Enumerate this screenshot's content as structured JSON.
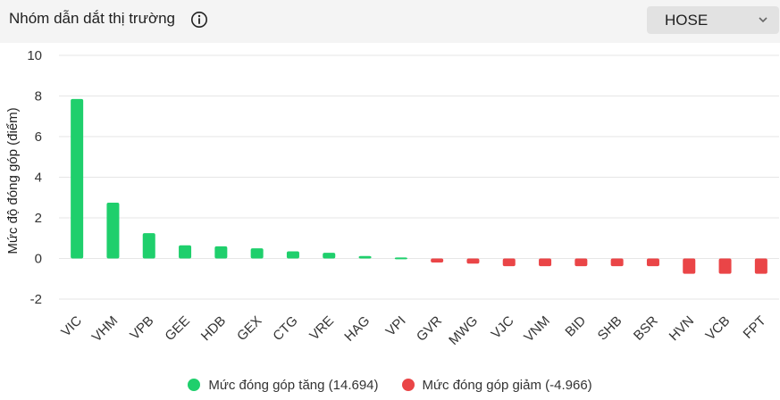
{
  "header": {
    "title": "Nhóm dẫn dắt thị trường",
    "info_icon": "info-circle-icon",
    "exchange": {
      "selected": "HOSE",
      "icon": "chevron-down-icon"
    }
  },
  "colors": {
    "up": "#1fcf6c",
    "down": "#ea4547",
    "grid": "#e6e6e6",
    "axis_text": "#333333"
  },
  "chart_data": {
    "type": "bar",
    "ylabel": "Mức độ đóng góp (điểm)",
    "ylim": [
      -2,
      10
    ],
    "yticks": [
      10,
      8,
      6,
      4,
      2,
      0,
      -2
    ],
    "grid": true,
    "legend_position": "bottom",
    "categories": [
      "VIC",
      "VHM",
      "VPB",
      "GEE",
      "HDB",
      "GEX",
      "CTG",
      "VRE",
      "HAG",
      "VPI",
      "GVR",
      "MWG",
      "VJC",
      "VNM",
      "BID",
      "SHB",
      "BSR",
      "HVN",
      "VCB",
      "FPT"
    ],
    "series": [
      {
        "name": "Mức đóng góp tăng (14.694)",
        "values": [
          7.85,
          2.75,
          1.25,
          0.65,
          0.6,
          0.5,
          0.35,
          0.28,
          0.12,
          0.05,
          null,
          null,
          null,
          null,
          null,
          null,
          null,
          null,
          null,
          null
        ]
      },
      {
        "name": "Mức đóng góp giảm (-4.966)",
        "values": [
          null,
          null,
          null,
          null,
          null,
          null,
          null,
          null,
          null,
          null,
          -0.2,
          -0.25,
          -0.38,
          -0.38,
          -0.38,
          -0.38,
          -0.38,
          -0.75,
          -0.75,
          -0.75
        ]
      }
    ]
  }
}
